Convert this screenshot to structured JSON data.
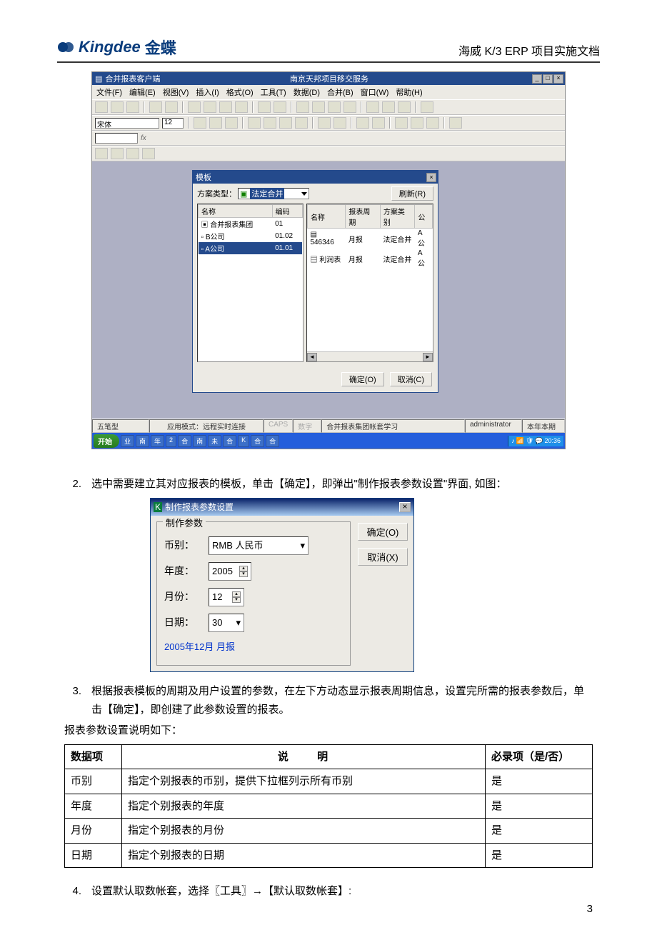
{
  "header": {
    "brand_en": "Kingdee",
    "brand_cn": "金蝶",
    "doc_title": "海威 K/3 ERP 项目实施文档"
  },
  "shot1": {
    "window_title": "合并报表客户端",
    "center_title": "南京天邦项目移交服务",
    "menus": [
      "文件(F)",
      "编辑(E)",
      "视图(V)",
      "插入(I)",
      "格式(O)",
      "工具(T)",
      "数据(D)",
      "合并(B)",
      "窗口(W)",
      "帮助(H)"
    ],
    "font_name": "宋体",
    "font_size": "12",
    "modal": {
      "title": "模板",
      "scheme_label": "方案类型：",
      "scheme_value": "法定合并",
      "refresh_btn": "刷新(R)",
      "left_headers": [
        "名称",
        "编码"
      ],
      "left_rows": [
        {
          "name": "合并报表集团",
          "code": "01"
        },
        {
          "name": "B公司",
          "code": "01.02"
        },
        {
          "name": "A公司",
          "code": "01.01"
        }
      ],
      "right_headers": [
        "名称",
        "报表周期",
        "方案类别",
        "公"
      ],
      "right_rows": [
        {
          "name": "546346",
          "period": "月报",
          "type": "法定合并",
          "ext": "A公"
        },
        {
          "name": "利润表",
          "period": "月报",
          "type": "法定合并",
          "ext": "A公"
        }
      ],
      "ok_btn": "确定(O)",
      "cancel_btn": "取消(C)"
    },
    "status": {
      "ime": "五笔型",
      "mode": "应用模式：远程实时连接",
      "caps": "CAPS",
      "num": "数字",
      "learn": "合并报表集团帐套学习",
      "user": "administrator",
      "period": "本年本期"
    },
    "taskbar": {
      "start": "开始",
      "items": [
        "业",
        "南",
        "年",
        "2",
        "合",
        "南",
        "未",
        "合",
        "K",
        "合",
        "合"
      ],
      "time": "20:36"
    }
  },
  "step2": {
    "num": "2.",
    "text": "选中需要建立其对应报表的模板，单击【确定】，即弹出\"制作报表参数设置\"界面, 如图："
  },
  "dlg2": {
    "title": "制作报表参数设置",
    "group_label": "制作参数",
    "currency_label": "币别：",
    "currency_value": "RMB  人民币",
    "year_label": "年度：",
    "year_value": "2005",
    "month_label": "月份：",
    "month_value": "12",
    "date_label": "日期：",
    "date_value": "30",
    "ok": "确定(O)",
    "cancel": "取消(X)",
    "period_text": "2005年12月 月报"
  },
  "step3": {
    "num": "3.",
    "text": "根据报表模板的周期及用户设置的参数，在左下方动态显示报表周期信息，设置完所需的报表参数后，单击【确定】，即创建了此参数设置的报表。"
  },
  "table_intro": "报表参数设置说明如下：",
  "table": {
    "headers": [
      "数据项",
      "说    明",
      "必录项（是/否）"
    ],
    "rows": [
      {
        "item": "币别",
        "desc": "指定个别报表的币别，提供下拉框列示所有币别",
        "req": "是"
      },
      {
        "item": "年度",
        "desc": "指定个别报表的年度",
        "req": "是"
      },
      {
        "item": "月份",
        "desc": "指定个别报表的月份",
        "req": "是"
      },
      {
        "item": "日期",
        "desc": "指定个别报表的日期",
        "req": "是"
      }
    ]
  },
  "step4": {
    "num": "4.",
    "text": "设置默认取数帐套，选择〖工具〗→【默认取数帐套】:"
  },
  "page_number": "3"
}
